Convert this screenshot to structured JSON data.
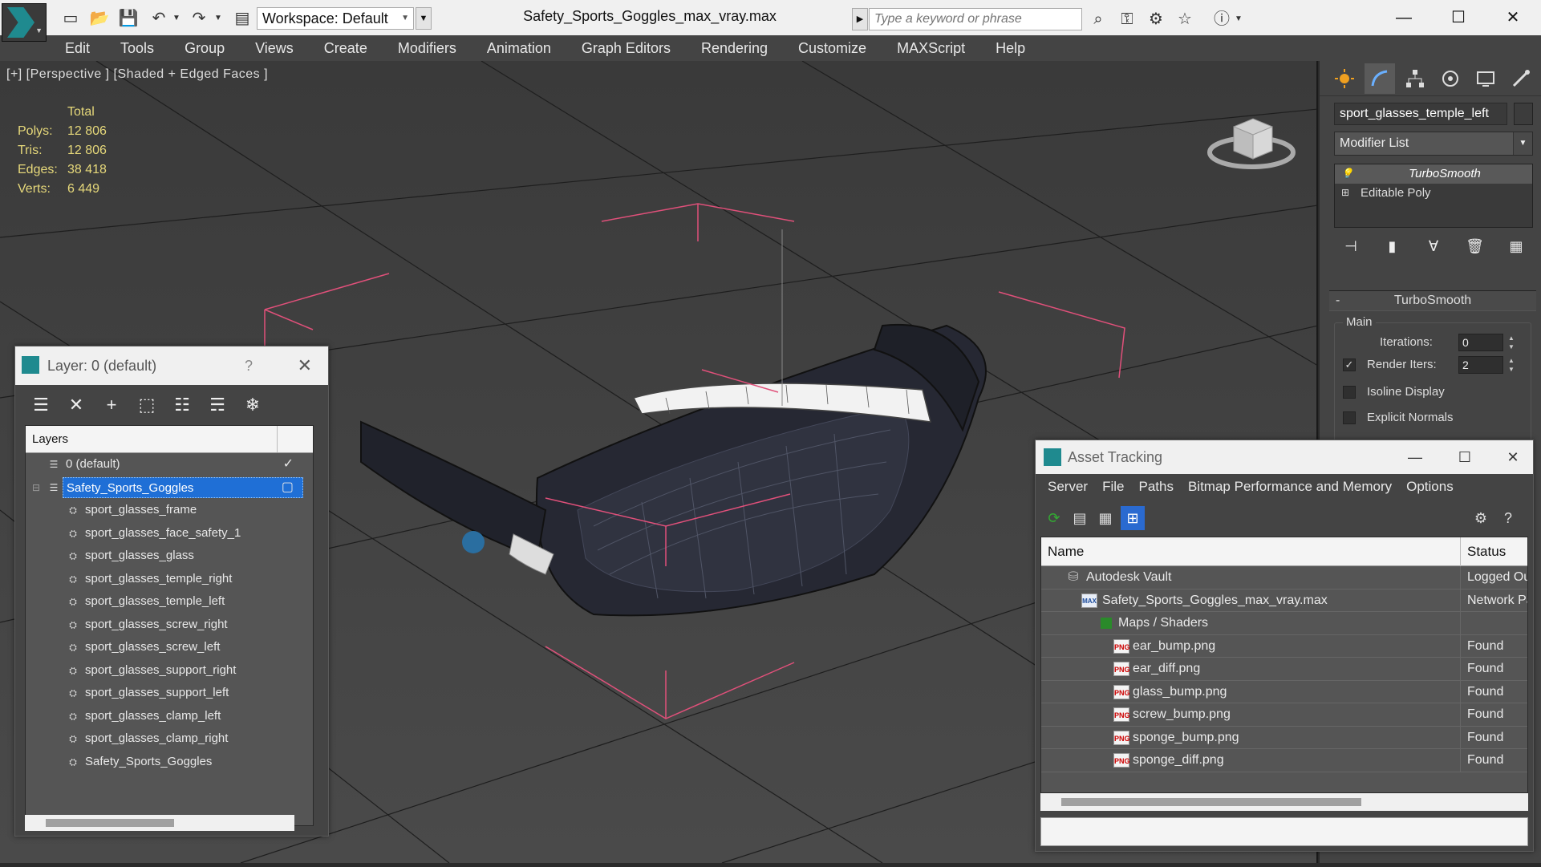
{
  "window": {
    "title": "Safety_Sports_Goggles_max_vray.max",
    "workspace": "Workspace: Default",
    "search_placeholder": "Type a keyword or phrase",
    "minimize": "—",
    "maximize": "☐",
    "close": "✕"
  },
  "menu": [
    "Edit",
    "Tools",
    "Group",
    "Views",
    "Create",
    "Modifiers",
    "Animation",
    "Graph Editors",
    "Rendering",
    "Customize",
    "MAXScript",
    "Help"
  ],
  "viewport": {
    "label": "[+] [Perspective ] [Shaded + Edged Faces ]",
    "stats": {
      "header": "Total",
      "rows": [
        {
          "label": "Polys:",
          "value": "12 806"
        },
        {
          "label": "Tris:",
          "value": "12 806"
        },
        {
          "label": "Edges:",
          "value": "38 418"
        },
        {
          "label": "Verts:",
          "value": "6 449"
        }
      ]
    },
    "stats_color": "#e6d87a",
    "selection_bracket_color": "#e0507a"
  },
  "command_panel": {
    "object_name": "sport_glasses_temple_left",
    "modifier_list": "Modifier List",
    "stack": [
      {
        "label": "TurboSmooth",
        "selected": true
      },
      {
        "label": "Editable Poly",
        "selected": false
      }
    ],
    "rollout": {
      "title": "TurboSmooth",
      "group": "Main",
      "iterations_label": "Iterations:",
      "iterations_value": "0",
      "render_iters_label": "Render Iters:",
      "render_iters_value": "2",
      "isoline_label": "Isoline Display",
      "explicit_normals_label": "Explicit Normals"
    }
  },
  "layer_dialog": {
    "title": "Layer: 0 (default)",
    "help": "?",
    "header": "Layers",
    "layers": [
      {
        "name": "0 (default)",
        "level": 0,
        "type": "layer",
        "mark": "✓"
      },
      {
        "name": "Safety_Sports_Goggles",
        "level": 0,
        "type": "layer",
        "selected": true,
        "mark": "▢"
      },
      {
        "name": "sport_glasses_frame",
        "level": 1,
        "type": "object"
      },
      {
        "name": "sport_glasses_face_safety_1",
        "level": 1,
        "type": "object"
      },
      {
        "name": "sport_glasses_glass",
        "level": 1,
        "type": "object"
      },
      {
        "name": "sport_glasses_temple_right",
        "level": 1,
        "type": "object"
      },
      {
        "name": "sport_glasses_temple_left",
        "level": 1,
        "type": "object"
      },
      {
        "name": "sport_glasses_screw_right",
        "level": 1,
        "type": "object"
      },
      {
        "name": "sport_glasses_screw_left",
        "level": 1,
        "type": "object"
      },
      {
        "name": "sport_glasses_support_right",
        "level": 1,
        "type": "object"
      },
      {
        "name": "sport_glasses_support_left",
        "level": 1,
        "type": "object"
      },
      {
        "name": "sport_glasses_clamp_left",
        "level": 1,
        "type": "object"
      },
      {
        "name": "sport_glasses_clamp_right",
        "level": 1,
        "type": "object"
      },
      {
        "name": "Safety_Sports_Goggles",
        "level": 1,
        "type": "object"
      }
    ]
  },
  "asset_dialog": {
    "title": "Asset Tracking",
    "menu": [
      "Server",
      "File",
      "Paths",
      "Bitmap Performance and Memory",
      "Options"
    ],
    "columns": [
      "Name",
      "Status"
    ],
    "rows": [
      {
        "name": "Autodesk Vault",
        "status": "Logged Ou",
        "level": 0,
        "icon": "vault"
      },
      {
        "name": "Safety_Sports_Goggles_max_vray.max",
        "status": "Network Pa",
        "level": 1,
        "icon": "max"
      },
      {
        "name": "Maps / Shaders",
        "status": "",
        "level": 2,
        "icon": "map"
      },
      {
        "name": "ear_bump.png",
        "status": "Found",
        "level": 3,
        "icon": "png"
      },
      {
        "name": "ear_diff.png",
        "status": "Found",
        "level": 3,
        "icon": "png"
      },
      {
        "name": "glass_bump.png",
        "status": "Found",
        "level": 3,
        "icon": "png"
      },
      {
        "name": "screw_bump.png",
        "status": "Found",
        "level": 3,
        "icon": "png"
      },
      {
        "name": "sponge_bump.png",
        "status": "Found",
        "level": 3,
        "icon": "png"
      },
      {
        "name": "sponge_diff.png",
        "status": "Found",
        "level": 3,
        "icon": "png"
      }
    ]
  }
}
